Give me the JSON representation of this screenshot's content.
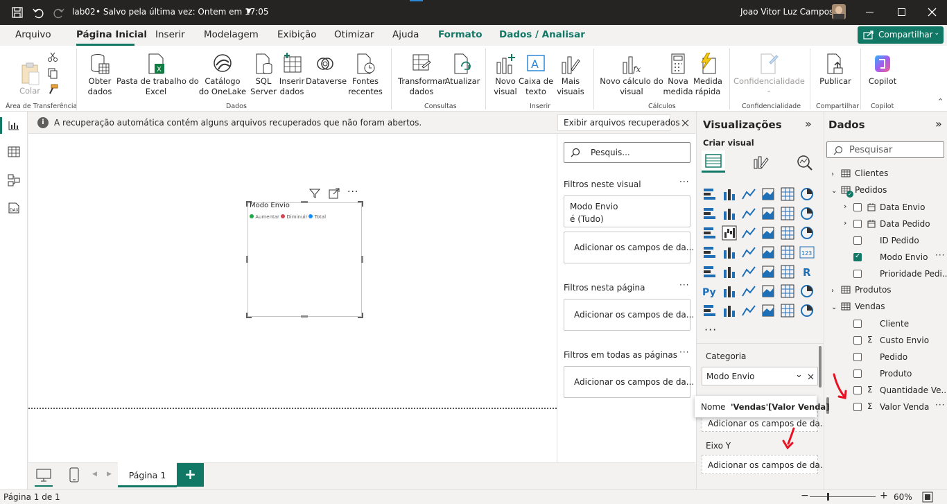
{
  "titlebar": {
    "filename": "lab02",
    "saved_status": "• Salvo pela última vez: Ontem em 17:05",
    "user_name": "Joao Vitor Luz Campos"
  },
  "menu": {
    "items": [
      "Arquivo",
      "Página Inicial",
      "Inserir",
      "Modelagem",
      "Exibição",
      "Otimizar",
      "Ajuda",
      "Formato",
      "Dados / Analisar"
    ],
    "share_label": "Compartilhar"
  },
  "ribbon": {
    "clipboard": {
      "paste": "Colar",
      "group": "Área de Transferência"
    },
    "data": {
      "get_data": "Obter\ndados",
      "excel": "Pasta de trabalho do\nExcel",
      "onelake": "Catálogo\ndo OneLake",
      "sql": "SQL\nServer",
      "enter_data": "Inserir\ndados",
      "dataverse": "Dataverse",
      "recent": "Fontes\nrecentes",
      "group": "Dados"
    },
    "queries": {
      "transform": "Transformar\ndados",
      "refresh": "Atualizar",
      "group": "Consultas"
    },
    "insert": {
      "new_visual": "Novo\nvisual",
      "textbox": "Caixa de\ntexto",
      "more_visuals": "Mais\nvisuais",
      "group": "Inserir"
    },
    "calc": {
      "new_calc": "Novo cálculo do\nvisual",
      "new_measure": "Nova\nmedida",
      "quick_measure": "Medida\nrápida",
      "group": "Cálculos"
    },
    "sensitivity": {
      "label": "Confidencialidade",
      "group": "Confidencialidade"
    },
    "share": {
      "publish": "Publicar",
      "group": "Compartilhar"
    },
    "copilot": {
      "label": "Copilot",
      "group": "Copilot"
    }
  },
  "infobar": {
    "message": "A recuperação automática contém alguns arquivos recuperados que não foram abertos.",
    "button": "Exibir arquivos recuperados"
  },
  "visual": {
    "title": "Modo Envio",
    "legend": [
      {
        "label": "Aumentar",
        "color": "#1aab40"
      },
      {
        "label": "Diminuir",
        "color": "#d64550"
      },
      {
        "label": "Total",
        "color": "#118dff"
      }
    ]
  },
  "filters": {
    "search_placeholder": "Pesquis...",
    "this_visual": "Filtros neste visual",
    "field_name": "Modo Envio",
    "field_state": "é (Tudo)",
    "add_fields": "Adicionar os campos de da...",
    "this_page": "Filtros nesta página",
    "all_pages": "Filtros em todas as páginas"
  },
  "viz": {
    "title": "Visualizações",
    "build_visual": "Criar visual",
    "category_label": "Categoria",
    "category_field": "Modo Envio",
    "tooltip_name_label": "Nome",
    "tooltip_name_value": "'Vendas'[Valor Venda]",
    "add_fields": "Adicionar os campos de da...",
    "y_axis_label": "Eixo Y"
  },
  "data": {
    "title": "Dados",
    "search_placeholder": "Pesquisar",
    "tables": [
      {
        "name": "Clientes"
      },
      {
        "name": "Pedidos",
        "fields": [
          {
            "name": "Data Envio",
            "checked": false
          },
          {
            "name": "Data Pedido",
            "checked": false
          },
          {
            "name": "ID Pedido",
            "checked": false
          },
          {
            "name": "Modo Envio",
            "checked": true
          },
          {
            "name": "Prioridade Pedi...",
            "checked": false
          }
        ]
      },
      {
        "name": "Produtos"
      },
      {
        "name": "Vendas",
        "fields": [
          {
            "name": "Cliente",
            "checked": false
          },
          {
            "name": "Custo Envio",
            "checked": false
          },
          {
            "name": "Pedido",
            "checked": false
          },
          {
            "name": "Produto",
            "checked": false
          },
          {
            "name": "Quantidade Ve...",
            "checked": false
          },
          {
            "name": "Valor Venda",
            "checked": false
          }
        ]
      }
    ]
  },
  "pages": {
    "tab": "Página 1",
    "add": "+"
  },
  "status": {
    "page_info": "Página 1 de 1",
    "zoom": "60%"
  },
  "colors": {
    "accent": "#117865",
    "titlebar": "#252423",
    "annotation_arrow": "#e81123"
  }
}
